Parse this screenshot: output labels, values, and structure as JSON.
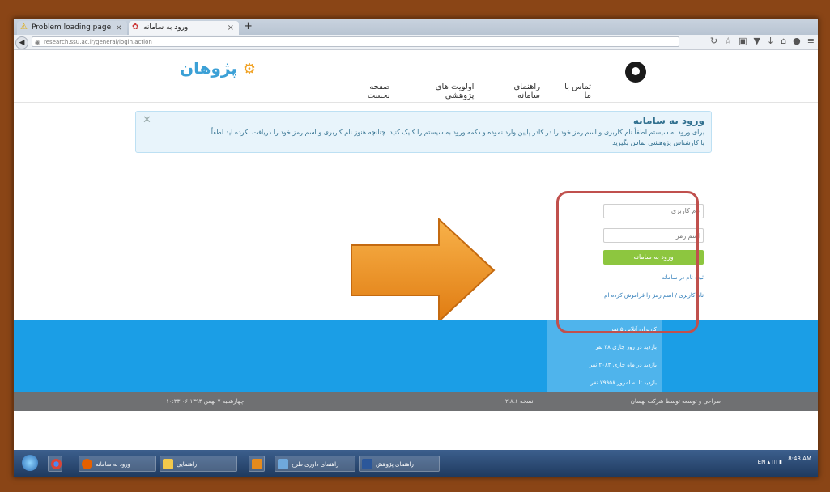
{
  "browser": {
    "tabs": [
      {
        "label": "Problem loading page",
        "icon": "warning-icon"
      },
      {
        "label": "ورود به سامانه",
        "icon": "site-icon"
      }
    ],
    "url": "research.ssu.ac.ir/general/login.action"
  },
  "site": {
    "brand": "پژوهان",
    "menu": [
      "صفحه نخست",
      "اولویت های پژوهشی",
      "راهنمای سامانه",
      "تماس با ما"
    ]
  },
  "alert": {
    "title": "ورود به سامانه",
    "line1": "برای ورود به سیستم لطفاً نام کاربری و اسم رمز خود را در کادر پایین وارد نموده و دکمه ورود به سیستم را کلیک کنید. چنانچه هنوز نام کاربری و اسم رمز خود را دریافت نکرده اید لطفاً",
    "line2": "با کارشناس پژوهشی تماس بگیرید"
  },
  "login": {
    "username_placeholder": "نام کاربری",
    "password_placeholder": "اسم رمز",
    "submit_label": "ورود به سامانه",
    "register_link": "ثبت نام در سامانه",
    "forgot_link": "نام کاربری / اسم رمز را فراموش کرده ام"
  },
  "stats": [
    "کاربران آنلاین   ۵ نفر",
    "بازدید در روز جاری   ۳۸ نفر",
    "بازدید در ماه جاری   ۲۰۸۳ نفر",
    "بازدید تا به امروز   ۷۹۹۵۸ نفر"
  ],
  "footer": {
    "right": "طراحی و توسعه توسط شرکت بهسان",
    "middle": "نسخه ۲.۸.۶",
    "left": "چهارشنبه ۷ بهمن ۱۳۹۴ ۱۰:۳۳:۰۶"
  },
  "taskbar": {
    "items": [
      "ورود به سامانه",
      "راهنمایی",
      "راهنمای داوری طرح",
      "راهنمای پژوهش"
    ],
    "lang": "EN",
    "time": "8:43 AM"
  },
  "colors": {
    "footer_blue": "#1b9ee6",
    "login_green": "#8dc63f",
    "annotation_red": "#c0504d",
    "arrow_orange": "#f29a2e"
  }
}
